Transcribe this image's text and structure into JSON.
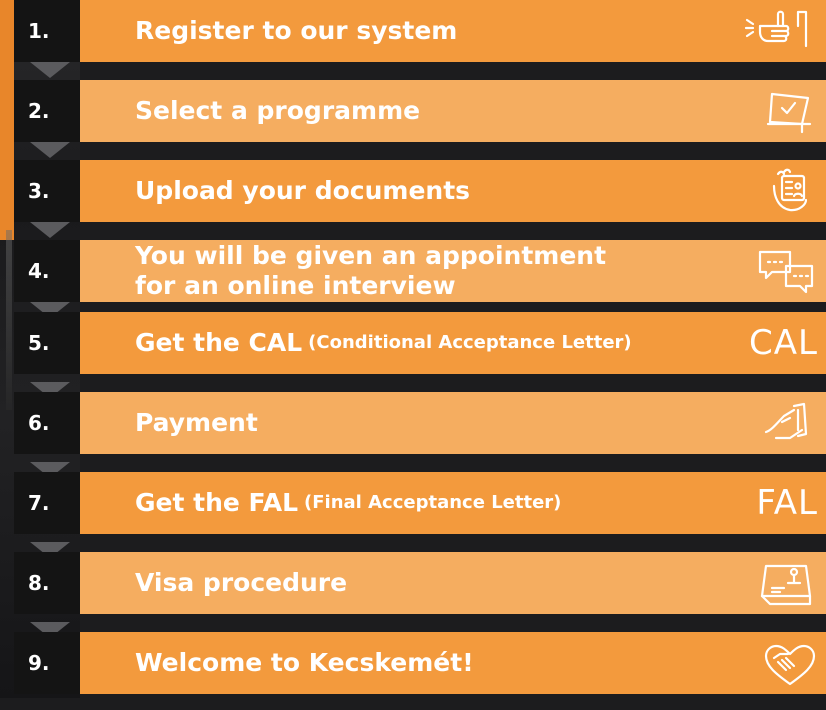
{
  "colors": {
    "band_dark": "#f39a3d",
    "band_light": "#f5ad60",
    "number_bg": "#141414",
    "arrow": "#5b5b5e",
    "text": "#ffffff"
  },
  "steps": [
    {
      "number": "1.",
      "title": "Register to our system",
      "subtitle": "",
      "icon": "hand-press-icon"
    },
    {
      "number": "2.",
      "title": "Select a programme",
      "subtitle": "",
      "icon": "checkbox-ballot-icon"
    },
    {
      "number": "3.",
      "title": "Upload your documents",
      "subtitle": "",
      "icon": "hand-document-icon"
    },
    {
      "number": "4.",
      "title": "You will be given an appointment",
      "title_line2": "for an online interview",
      "subtitle": "",
      "icon": "chat-bubbles-icon"
    },
    {
      "number": "5.",
      "title": "Get the CAL",
      "subtitle": "(Conditional Acceptance Letter)",
      "icon": "CAL"
    },
    {
      "number": "6.",
      "title": "Payment",
      "subtitle": "",
      "icon": "card-payment-icon"
    },
    {
      "number": "7.",
      "title": "Get the FAL",
      "subtitle": "(Final Acceptance Letter)",
      "icon": "FAL"
    },
    {
      "number": "8.",
      "title": "Visa procedure",
      "subtitle": "",
      "icon": "stamp-icon"
    },
    {
      "number": "9.",
      "title": "Welcome to Kecskemét!",
      "subtitle": "",
      "icon": "handshake-heart-icon"
    }
  ]
}
